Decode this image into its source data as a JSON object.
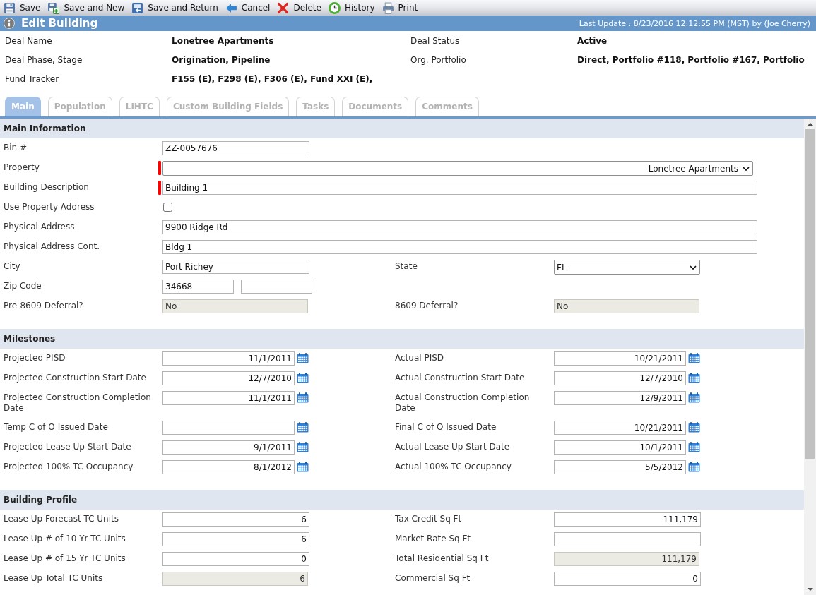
{
  "toolbar": [
    {
      "kind": "save",
      "label": "Save"
    },
    {
      "kind": "save_new",
      "label": "Save and New"
    },
    {
      "kind": "save_return",
      "label": "Save and Return"
    },
    {
      "kind": "cancel",
      "label": "Cancel"
    },
    {
      "kind": "delete",
      "label": "Delete"
    },
    {
      "kind": "history",
      "label": "History"
    },
    {
      "kind": "print",
      "label": "Print"
    }
  ],
  "header": {
    "title": "Edit Building",
    "last_update": "Last Update : 8/23/2016 12:12:55 PM (MST) by (Joe Cherry)"
  },
  "summary": [
    {
      "label": "Deal Name",
      "value": "Lonetree Apartments"
    },
    {
      "label": "Deal Status",
      "value": "Active"
    },
    {
      "label": "Deal Phase, Stage",
      "value": "Origination, Pipeline"
    },
    {
      "label": "Org. Portfolio",
      "value": "Direct, Portfolio #118, Portfolio #167, Portfolio"
    },
    {
      "label": "Fund Tracker",
      "value": "F155 (E), F298 (E), F306 (E), Fund XXI (E),"
    }
  ],
  "tabs": [
    {
      "label": "Main",
      "selected": true
    },
    {
      "label": "Population",
      "selected": false
    },
    {
      "label": "LIHTC",
      "selected": false
    },
    {
      "label": "Custom Building Fields",
      "selected": false
    },
    {
      "label": "Tasks",
      "selected": false
    },
    {
      "label": "Documents",
      "selected": false
    },
    {
      "label": "Comments",
      "selected": false
    }
  ],
  "sections": [
    {
      "title": "Main Information",
      "rows": [
        [
          {
            "label": "Bin #",
            "kind": "text",
            "value": "ZZ-0057676",
            "required": false
          }
        ],
        [
          {
            "label": "Property",
            "kind": "long_select",
            "value": "Lonetree Apartments",
            "required": true
          }
        ],
        [
          {
            "label": "Building Description",
            "kind": "long_text",
            "value": "Building 1",
            "required": true
          }
        ],
        [
          {
            "label": "Use Property Address",
            "kind": "checkbox",
            "checked": false,
            "required": false
          }
        ],
        [
          {
            "label": "Physical Address",
            "kind": "long_text",
            "value": "9900 Ridge Rd",
            "required": false
          }
        ],
        [
          {
            "label": "Physical Address Cont.",
            "kind": "long_text",
            "value": "Bldg 1",
            "required": false
          }
        ],
        [
          {
            "label": "City",
            "kind": "text",
            "value": "Port Richey",
            "required": false
          },
          {
            "label": "State",
            "kind": "select",
            "value": "FL",
            "required": false
          }
        ],
        [
          {
            "label": "Zip Code",
            "kind": "zip",
            "value": "34668",
            "required": false
          }
        ],
        [
          {
            "label": "Pre-8609 Deferral?",
            "kind": "readonly_text",
            "value": "No",
            "required": false
          },
          {
            "label": "8609 Deferral?",
            "kind": "readonly_text",
            "value": "No",
            "required": false
          }
        ]
      ]
    },
    {
      "title": "Milestones",
      "rows": [
        [
          {
            "label": "Projected PISD",
            "kind": "date",
            "value": "11/1/2011",
            "required": false
          },
          {
            "label": "Actual PISD",
            "kind": "date",
            "value": "10/21/2011",
            "required": false
          }
        ],
        [
          {
            "label": "Projected Construction Start Date",
            "kind": "date",
            "value": "12/7/2010",
            "required": false
          },
          {
            "label": "Actual Construction Start Date",
            "kind": "date",
            "value": "12/7/2010",
            "required": false
          }
        ],
        [
          {
            "label": "Projected Construction Completion Date",
            "kind": "date",
            "value": "11/1/2011",
            "required": false
          },
          {
            "label": "Actual Construction Completion Date",
            "kind": "date",
            "value": "12/9/2011",
            "required": false
          }
        ],
        [
          {
            "label": "Temp C of O Issued Date",
            "kind": "date",
            "required": false
          },
          {
            "label": "Final C of O Issued Date",
            "kind": "date",
            "value": "10/21/2011",
            "required": false
          }
        ],
        [
          {
            "label": "Projected Lease Up Start Date",
            "kind": "date",
            "value": "9/1/2011",
            "required": false
          },
          {
            "label": "Actual Lease Up Start Date",
            "kind": "date",
            "value": "10/1/2011",
            "required": false
          }
        ],
        [
          {
            "label": "Projected 100% TC Occupancy",
            "kind": "date",
            "value": "8/1/2012",
            "required": false
          },
          {
            "label": "Actual 100% TC Occupancy",
            "kind": "date",
            "value": "5/5/2012",
            "required": false
          }
        ]
      ]
    },
    {
      "title": "Building Profile",
      "rows": [
        [
          {
            "label": "Lease Up Forecast TC Units",
            "kind": "number",
            "value": "6",
            "required": false
          },
          {
            "label": "Tax Credit Sq Ft",
            "kind": "number",
            "value": "111,179",
            "required": false
          }
        ],
        [
          {
            "label": "Lease Up # of 10 Yr TC Units",
            "kind": "number",
            "value": "6",
            "required": false
          },
          {
            "label": "Market Rate Sq Ft",
            "kind": "number",
            "required": false
          }
        ],
        [
          {
            "label": "Lease Up # of 15 Yr TC Units",
            "kind": "number",
            "value": "0",
            "required": false
          },
          {
            "label": "Total Residential Sq Ft",
            "kind": "readonly_number",
            "value": "111,179",
            "required": false
          }
        ],
        [
          {
            "label": "Lease Up Total TC Units",
            "kind": "readonly_number",
            "value": "6",
            "required": false
          },
          {
            "label": "Commercial Sq Ft",
            "kind": "number",
            "value": "0",
            "required": false
          }
        ]
      ]
    }
  ]
}
